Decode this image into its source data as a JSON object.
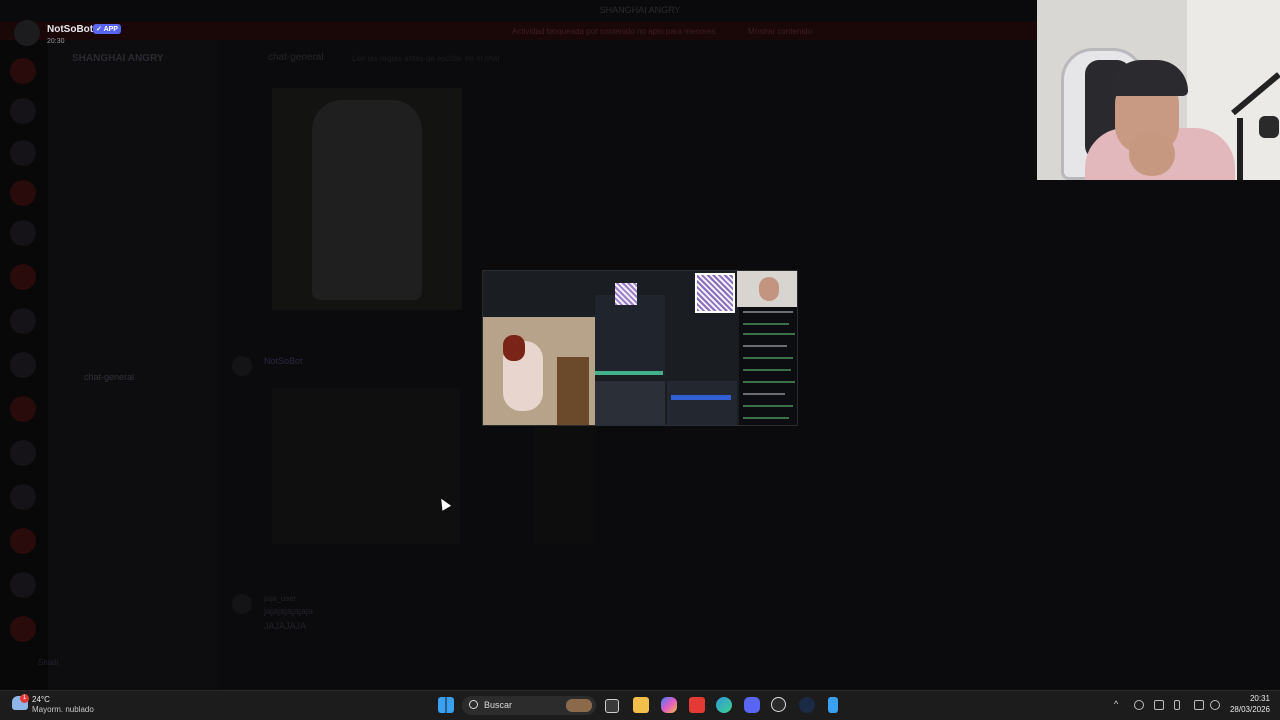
{
  "window": {
    "title": "SHANGHAI ANGRY"
  },
  "notification": {
    "bot_name": "NotSoBot",
    "badge": "APP",
    "time": "20:30"
  },
  "notice": {
    "text": "Actividad bloqueada por contenido no apto para menores",
    "link": "Mostrar contenido"
  },
  "server": {
    "name": "SHANGHAI ANGRY"
  },
  "chat": {
    "header": "chat-general",
    "topic": "Lee las reglas antes de escribir en el chat"
  },
  "messages": {
    "bot_name": "NotSoBot",
    "author": "jaja_user",
    "line1": "jajajajajajaja",
    "line2": "JAJAJAJA"
  },
  "user": {
    "name": "Shadi"
  },
  "taskbar": {
    "weather_temp": "24°C",
    "weather_desc": "Mayorm. nublado",
    "weather_badge": "1",
    "search_placeholder": "Buscar",
    "time": "20:31",
    "date": "28/03/2026",
    "apps": [
      "task-view-icon",
      "file-explorer-icon",
      "copilot-icon",
      "wps-icon",
      "edge-icon",
      "discord-icon",
      "chatgpt-icon",
      "steam-icon",
      "notepad-icon"
    ]
  },
  "colors": {
    "accent": "#5865f2",
    "taskbar": "#1c1c1c",
    "notice": "#1a0707"
  }
}
